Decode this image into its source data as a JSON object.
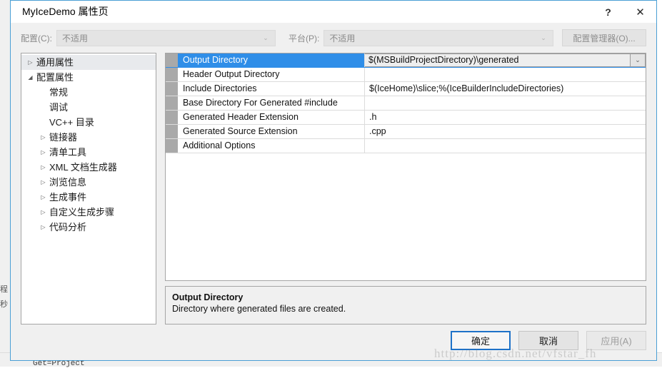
{
  "backdrop": {
    "left_fragment": "程\n秒",
    "bottom_fragment": "Get=Project"
  },
  "window": {
    "title": "MyIceDemo 属性页",
    "help_icon": "question-mark-icon",
    "help_label": "?",
    "close_icon": "close-icon",
    "close_label": "✕"
  },
  "config_bar": {
    "configuration_label": "配置(C):",
    "configuration_value": "不适用",
    "platform_label": "平台(P):",
    "platform_value": "不适用",
    "config_manager_button": "配置管理器(O)...",
    "chevron": "⌄"
  },
  "tree": {
    "items": [
      {
        "label": "通用属性",
        "level": 1,
        "twisty": "▷",
        "selected": true
      },
      {
        "label": "配置属性",
        "level": 1,
        "twisty": "◢",
        "selected": false
      },
      {
        "label": "常规",
        "level": 2,
        "twisty": "",
        "selected": false
      },
      {
        "label": "调试",
        "level": 2,
        "twisty": "",
        "selected": false
      },
      {
        "label": "VC++ 目录",
        "level": 2,
        "twisty": "",
        "selected": false
      },
      {
        "label": "链接器",
        "level": 2,
        "twisty": "▷",
        "selected": false
      },
      {
        "label": "清单工具",
        "level": 2,
        "twisty": "▷",
        "selected": false
      },
      {
        "label": "XML 文档生成器",
        "level": 2,
        "twisty": "▷",
        "selected": false
      },
      {
        "label": "浏览信息",
        "level": 2,
        "twisty": "▷",
        "selected": false
      },
      {
        "label": "生成事件",
        "level": 2,
        "twisty": "▷",
        "selected": false
      },
      {
        "label": "自定义生成步骤",
        "level": 2,
        "twisty": "▷",
        "selected": false
      },
      {
        "label": "代码分析",
        "level": 2,
        "twisty": "▷",
        "selected": false
      }
    ]
  },
  "property_grid": {
    "rows": [
      {
        "name": "Output Directory",
        "value": "$(MSBuildProjectDirectory)\\generated",
        "selected": true,
        "has_dropdown": true
      },
      {
        "name": "Header Output Directory",
        "value": "",
        "selected": false,
        "has_dropdown": false
      },
      {
        "name": "Include Directories",
        "value": "$(IceHome)\\slice;%(IceBuilderIncludeDirectories)",
        "selected": false,
        "has_dropdown": false
      },
      {
        "name": "Base Directory For Generated #include",
        "value": "",
        "selected": false,
        "has_dropdown": false
      },
      {
        "name": "Generated Header Extension",
        "value": ".h",
        "selected": false,
        "has_dropdown": false
      },
      {
        "name": "Generated Source Extension",
        "value": ".cpp",
        "selected": false,
        "has_dropdown": false
      },
      {
        "name": "Additional Options",
        "value": "",
        "selected": false,
        "has_dropdown": false
      }
    ],
    "dropdown_chevron": "⌄"
  },
  "description": {
    "title": "Output Directory",
    "text": "Directory where generated files are created."
  },
  "footer": {
    "ok_label": "确定",
    "cancel_label": "取消",
    "apply_label": "应用(A)"
  },
  "watermark": {
    "text": "http://blog.csdn.net/vfstar_fh"
  },
  "colors": {
    "selection_blue": "#2f8ee8",
    "dialog_border": "#4a9fd5",
    "default_button_border": "#1e72c8",
    "gutter_gray": "#a9a9a9"
  }
}
